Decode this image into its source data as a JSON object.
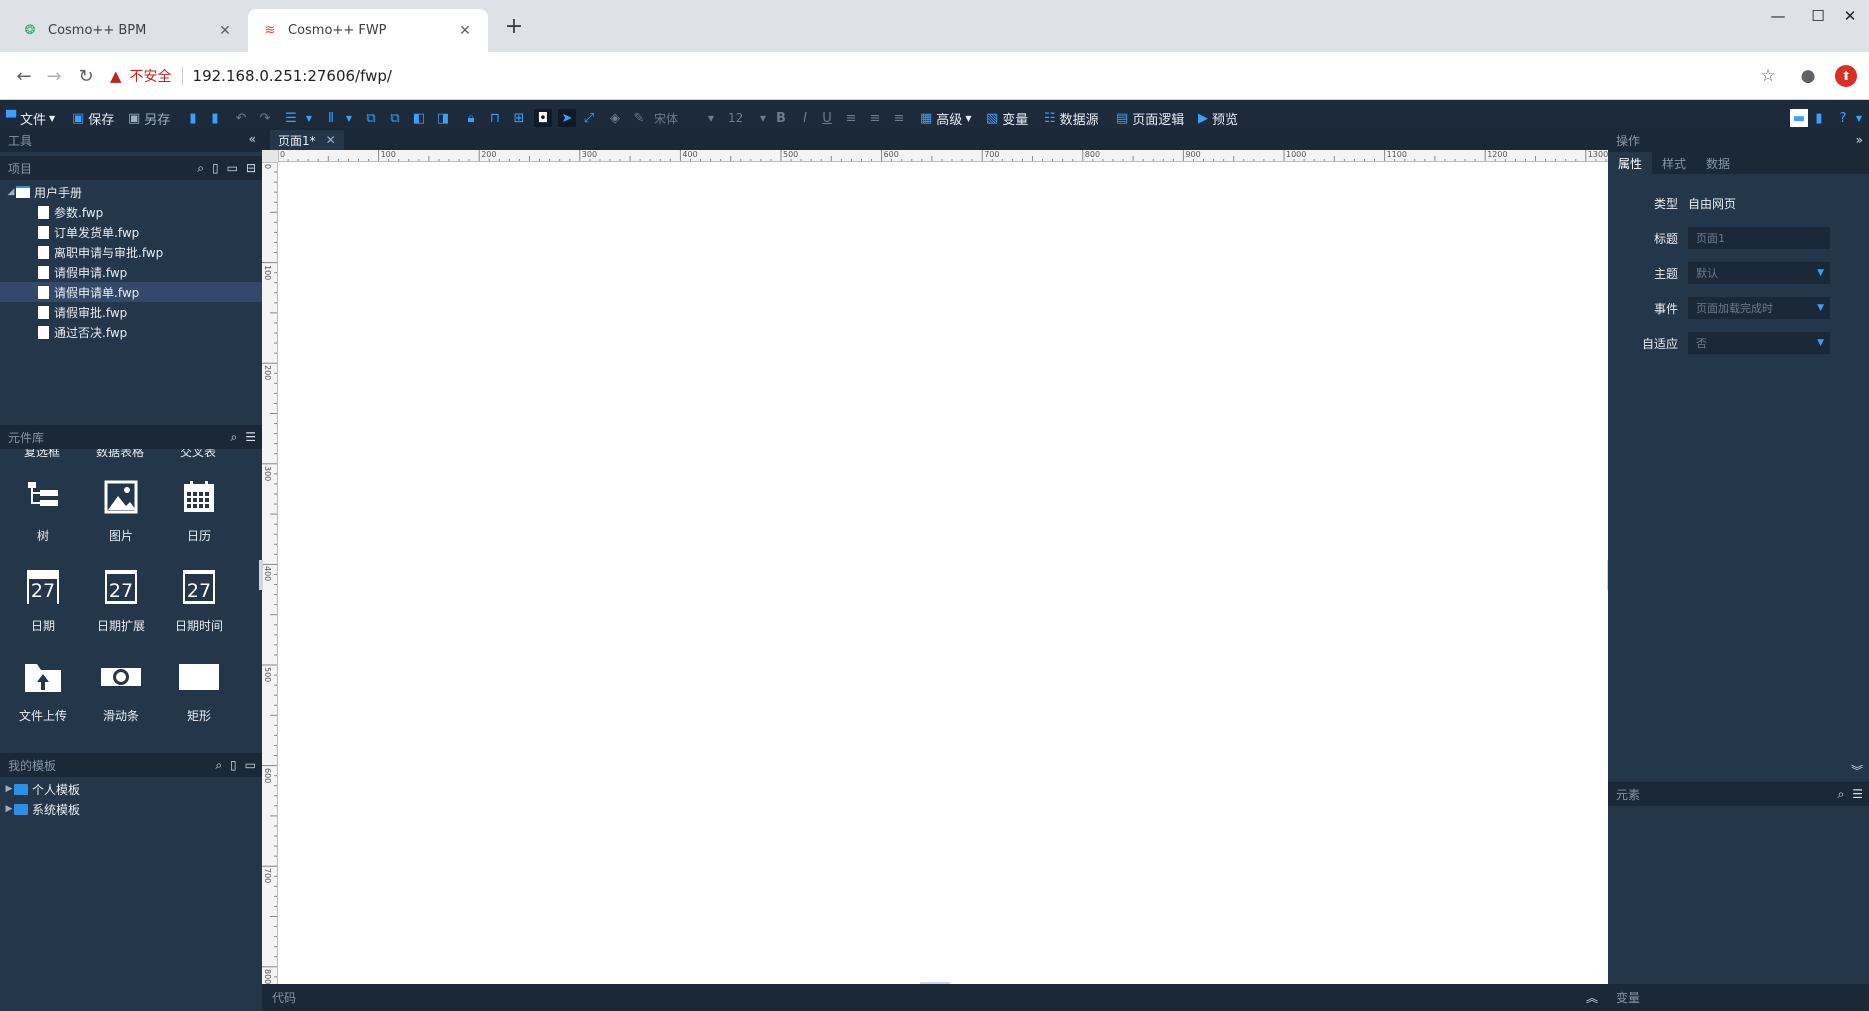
{
  "browser": {
    "tabs": [
      {
        "title": "Cosmo++ BPM",
        "active": false,
        "favicon": "bpm-logo-icon"
      },
      {
        "title": "Cosmo++ FWP",
        "active": true,
        "favicon": "fwp-logo-icon"
      }
    ],
    "insecure_label": "不安全",
    "url": "192.168.0.251:27606/fwp/"
  },
  "toolbar": {
    "file": "文件",
    "save": "保存",
    "save_as": "另存",
    "font": "宋体",
    "font_size": "12",
    "advanced": "高级",
    "variables": "变量",
    "datasource": "数据源",
    "page_logic": "页面逻辑",
    "preview": "预览"
  },
  "left": {
    "tools_title": "工具",
    "project_title": "项目",
    "project_tree": {
      "root": "用户手册",
      "files": [
        "参数.fwp",
        "订单发货单.fwp",
        "离职申请与审批.fwp",
        "请假申请.fwp",
        "请假申请单.fwp",
        "请假审批.fwp",
        "通过否决.fwp"
      ],
      "selected_index": 4
    },
    "components_title": "元件库",
    "cut_labels": [
      "复选框",
      "数据表格",
      "交叉表"
    ],
    "components": [
      {
        "label": "树",
        "icon": "tree-icon"
      },
      {
        "label": "图片",
        "icon": "image-icon"
      },
      {
        "label": "日历",
        "icon": "calendar-grid-icon"
      },
      {
        "label": "日期",
        "icon": "date-icon"
      },
      {
        "label": "日期扩展",
        "icon": "date-ext-icon"
      },
      {
        "label": "日期时间",
        "icon": "datetime-icon"
      },
      {
        "label": "文件上传",
        "icon": "file-upload-icon"
      },
      {
        "label": "滑动条",
        "icon": "slider-icon"
      },
      {
        "label": "矩形",
        "icon": "rectangle-icon"
      }
    ],
    "calendar_day": "27",
    "templates_title": "我的模板",
    "templates": [
      "个人模板",
      "系统模板"
    ]
  },
  "editor": {
    "doc_tab": "页面1*",
    "ruler_top": [
      "0",
      "100",
      "200",
      "300",
      "400",
      "500",
      "600",
      "700",
      "800",
      "900",
      "1000",
      "1100",
      "1200",
      "1300"
    ],
    "ruler_left": [
      "0",
      "100",
      "200",
      "300",
      "400",
      "500",
      "600",
      "700",
      "800"
    ],
    "code_label": "代码"
  },
  "right": {
    "ops_title": "操作",
    "tabs": [
      "属性",
      "样式",
      "数据"
    ],
    "props": {
      "type_label": "类型",
      "type_value": "自由网页",
      "title_label": "标题",
      "title_value": "页面1",
      "theme_label": "主题",
      "theme_value": "默认",
      "event_label": "事件",
      "event_value": "页面加载完成时",
      "adaptive_label": "自适应",
      "adaptive_value": "否"
    },
    "elements_title": "元素",
    "variables_title": "变量"
  },
  "colors": {
    "panel": "#24364a",
    "header": "#1a2838",
    "accent": "#3aa0ff"
  }
}
